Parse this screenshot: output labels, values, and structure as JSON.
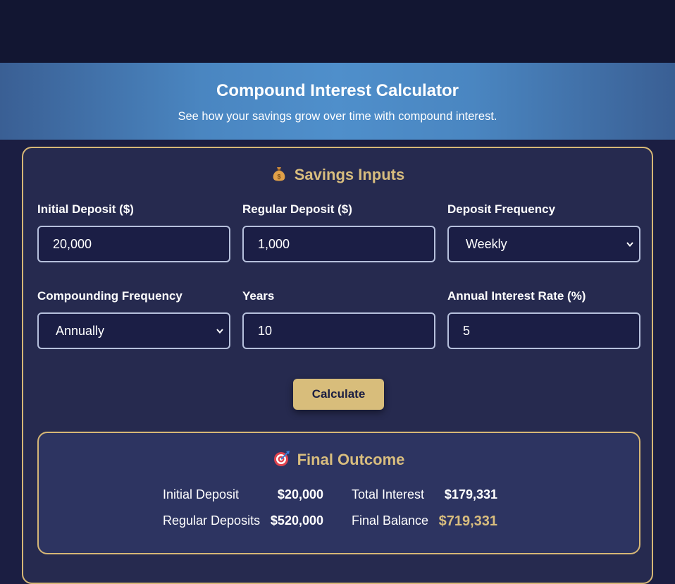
{
  "header": {
    "title": "Compound Interest Calculator",
    "subtitle": "See how your savings grow over time with compound interest."
  },
  "inputs": {
    "title": "Savings Inputs",
    "title_icon": "money-bag",
    "initial_deposit": {
      "label": "Initial Deposit ($)",
      "value": "20,000"
    },
    "regular_deposit": {
      "label": "Regular Deposit ($)",
      "value": "1,000"
    },
    "deposit_frequency": {
      "label": "Deposit Frequency",
      "value": "Weekly"
    },
    "compounding_frequency": {
      "label": "Compounding Frequency",
      "value": "Annually"
    },
    "years": {
      "label": "Years",
      "value": "10"
    },
    "interest_rate": {
      "label": "Annual Interest Rate (%)",
      "value": "5"
    },
    "calculate_label": "Calculate"
  },
  "outcome": {
    "title": "Final Outcome",
    "title_icon": "target",
    "initial_deposit": {
      "label": "Initial Deposit",
      "value": "$20,000"
    },
    "regular_deposits": {
      "label": "Regular Deposits",
      "value": "$520,000"
    },
    "total_interest": {
      "label": "Total Interest",
      "value": "$179,331"
    },
    "final_balance": {
      "label": "Final Balance",
      "value": "$719,331"
    }
  },
  "colors": {
    "accent_gold": "#d8bd7e",
    "background": "#1b1e42",
    "card": "#262a4f",
    "header_blue": "#4f8fcb"
  }
}
